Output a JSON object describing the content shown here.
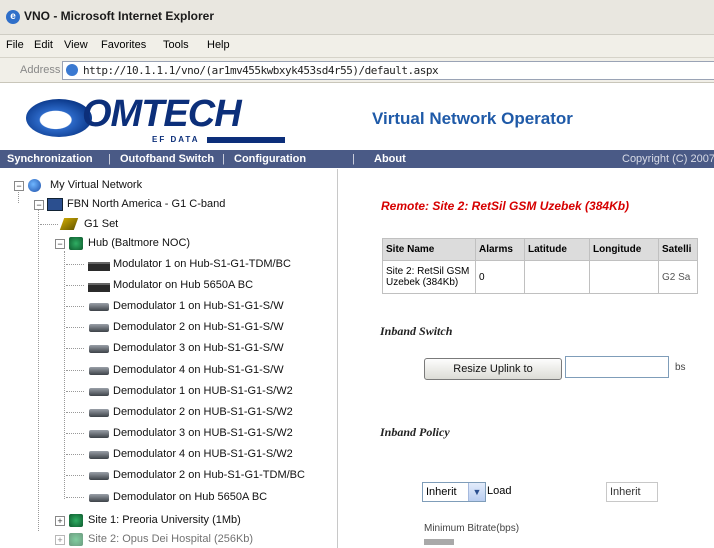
{
  "window": {
    "title": "VNO - Microsoft Internet Explorer",
    "icon": "ie-icon"
  },
  "menu": [
    "File",
    "Edit",
    "View",
    "Favorites",
    "Tools",
    "Help"
  ],
  "address": {
    "label": "Address",
    "url": "http://10.1.1.1/vno/(ar1mv455kwbxyk453sd4r55)/default.aspx"
  },
  "brand": {
    "name": "OMTECH",
    "sub": "EF DATA",
    "app_title": "Virtual Network Operator"
  },
  "nav": {
    "items": [
      "Synchronization",
      "Outofband Switch",
      "Configuration",
      "About"
    ],
    "copyright": "Copyright (C) 2007"
  },
  "tree": {
    "root": "My Virtual Network",
    "network": "FBN North America - G1 C-band",
    "g1set": "G1 Set",
    "hub": "Hub (Baltmore NOC)",
    "hub_children": [
      "Modulator 1 on Hub-S1-G1-TDM/BC",
      "Modulator on Hub 5650A BC",
      "Demodulator 1 on Hub-S1-G1-S/W",
      "Demodulator 2 on Hub-S1-G1-S/W",
      "Demodulator 3 on Hub-S1-G1-S/W",
      "Demodulator 4 on Hub-S1-G1-S/W",
      "Demodulator 1 on HUB-S1-G1-S/W2",
      "Demodulator 2 on HUB-S1-G1-S/W2",
      "Demodulator 3 on HUB-S1-G1-S/W2",
      "Demodulator 4 on HUB-S1-G1-S/W2",
      "Demodulator 2 on Hub-S1-G1-TDM/BC",
      "Demodulator on Hub 5650A BC"
    ],
    "sites": [
      "Site 1: Preoria University (1Mb)",
      "Site 2: Opus Dei Hospital (256Kb)"
    ]
  },
  "detail": {
    "heading": "Remote: Site 2: RetSil GSM Uzebek (384Kb)",
    "table": {
      "headers": [
        "Site Name",
        "Alarms",
        "Latitude",
        "Longitude",
        "Satelli"
      ],
      "row": [
        "Site 2: RetSil GSM Uzebek (384Kb)",
        "0",
        "",
        "",
        "G2 Sa"
      ]
    },
    "inband_switch": {
      "heading": "Inband Switch",
      "button": "Resize Uplink to",
      "value": "",
      "unit": "bs"
    },
    "inband_policy": {
      "heading": "Inband Policy",
      "select": "Inherit",
      "load_label": "Load",
      "inherit_value": "Inherit",
      "min_bitrate_label": "Minimum Bitrate(bps)"
    }
  }
}
